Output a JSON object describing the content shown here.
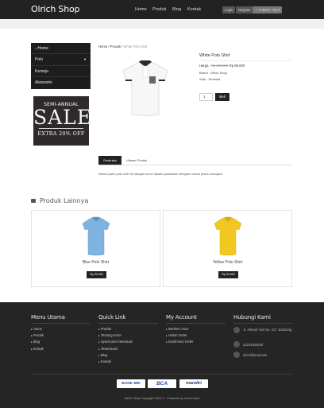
{
  "navbar": {
    "brand": "Olrich Shop",
    "links": [
      "Home",
      "Produk",
      "Blog",
      "Kontak"
    ],
    "login": "Login",
    "register": "Register",
    "cart": "0 items - Rp 0"
  },
  "sidebar": {
    "items": [
      {
        "label": "Home"
      },
      {
        "label": "Polo"
      },
      {
        "label": "Kemeja"
      },
      {
        "label": "Aksesoris"
      }
    ],
    "promo": {
      "line1": "SEMI-ANNUAL",
      "line2": "SALE",
      "line3": "EXTRA 20% OFF"
    }
  },
  "breadcrumb": {
    "home": "Home",
    "sep1": " / ",
    "category": "Produk",
    "sep2": " / ",
    "current": "White Polo Shirt"
  },
  "product": {
    "title": "White Polo Shirt",
    "price_label": "Harga : ",
    "price_old": "Rp 105.000",
    "price_new": " Rp 95.000",
    "brand": "Brand : Olrich Shop",
    "stock": "Stok : Tersedia",
    "qty": "1",
    "buy_label": "Beli"
  },
  "tabs": {
    "description": "Deskripsi",
    "reviews": "Ulasan Produk",
    "content": "Warna putih polo shirt ini sangat cocok dipadu-padankan dengan celana jeans manapun"
  },
  "related": {
    "title": "Produk Lainnya",
    "items": [
      {
        "name": "Blue Polo Shirt",
        "price": "Rp 90.000",
        "color": "#7fb3e0"
      },
      {
        "name": "Yellow Polo Shirt",
        "price": "Rp 90.000",
        "color": "#f2c722"
      }
    ]
  },
  "footer": {
    "menu": {
      "title": "Menu Utama",
      "links": [
        "Home",
        "Produk",
        "Blog",
        "Kontak"
      ]
    },
    "quick": {
      "title": "Quick Link",
      "links": [
        "Produk",
        "Tentang Kami",
        "Syarat dan Ketentuan",
        "Testimonial",
        "Blog",
        "Kontak"
      ]
    },
    "account": {
      "title": "My Account",
      "links": [
        "Member Area",
        "Histori Order",
        "Konfirmasi Order"
      ]
    },
    "contact": {
      "title": "Hubungi Kami",
      "address": "Jl. Ahmad Yani No. 217, Bandung",
      "phone": "02241835535",
      "email": "olrich@mail.com"
    },
    "banks": [
      "BANK BRI",
      "BCA",
      "mandiri"
    ],
    "copyright": "Olrich Shop Copyright 2015 © - Powered by Jarvis Store"
  }
}
